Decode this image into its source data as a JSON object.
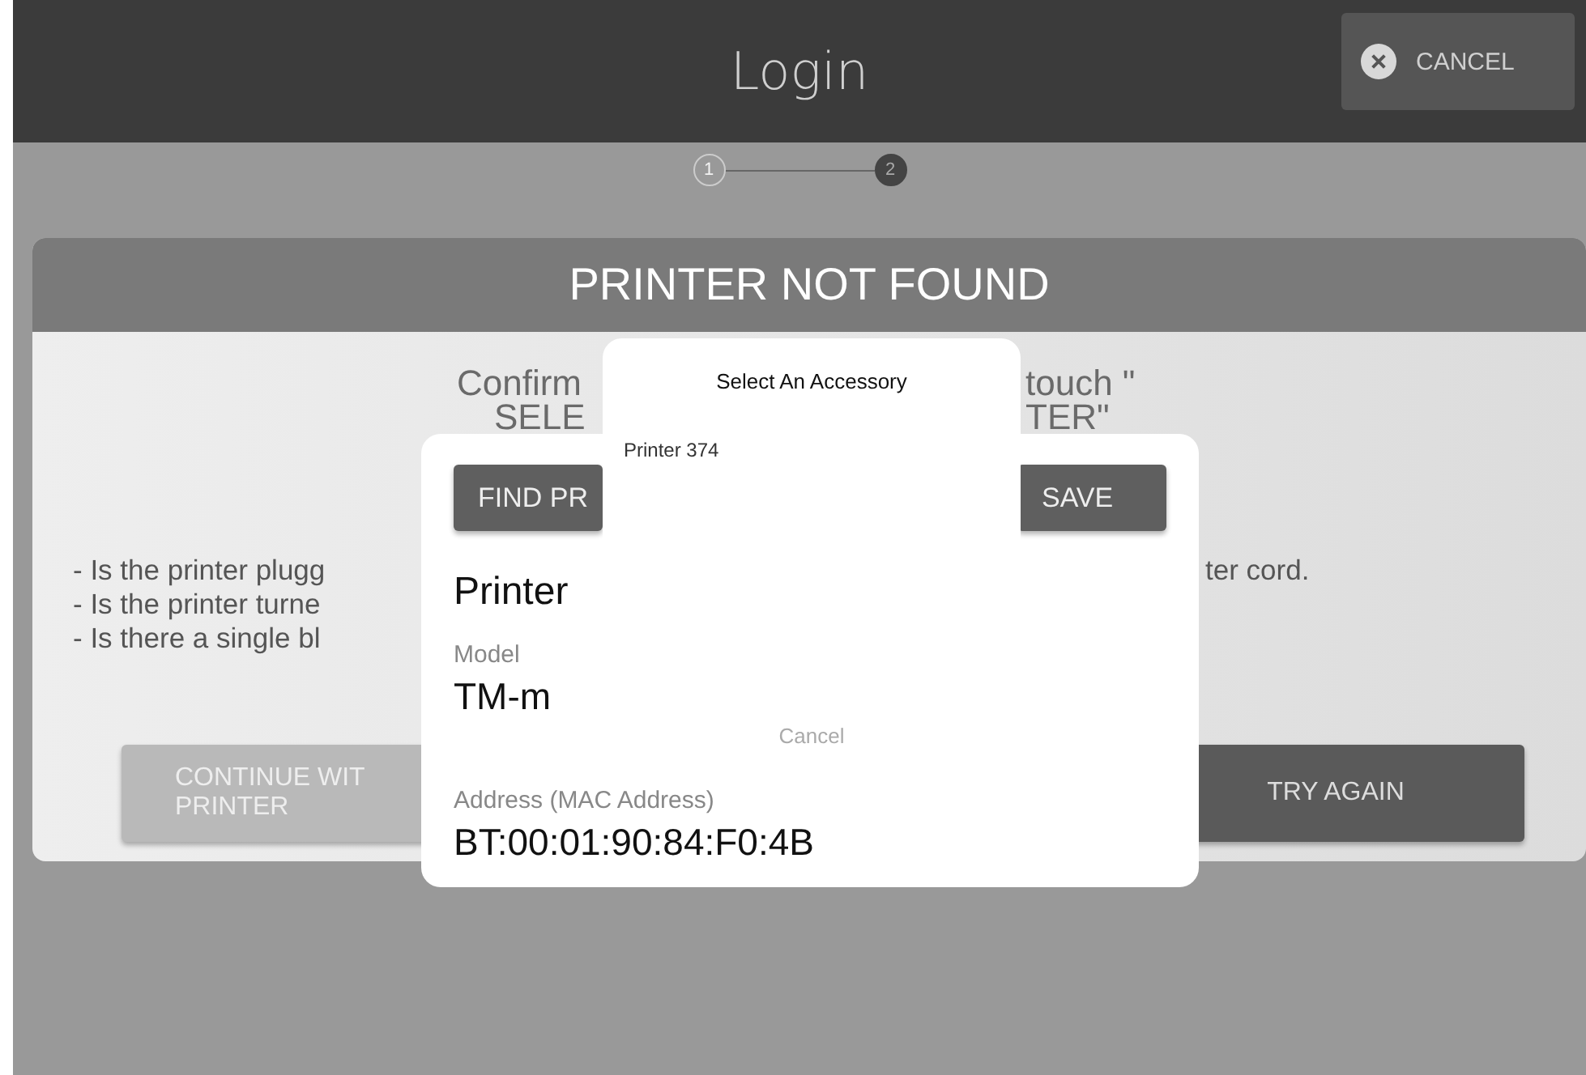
{
  "header": {
    "title": "Login",
    "cancel_button": "CANCEL"
  },
  "stepper": {
    "steps": [
      {
        "label": "1",
        "selected": false
      },
      {
        "label": "2",
        "selected": true
      }
    ]
  },
  "alert": {
    "title": "PRINTER NOT FOUND",
    "message_fragments": [
      "Confirm",
      "touch \"",
      "SELE",
      "TER\""
    ],
    "checklist": [
      "- Is the printer plugg",
      "- Is the printer turne",
      "- Is there a single bl"
    ],
    "checklist_tail": "ter cord.",
    "buttons": [
      {
        "lines": [
          "CONTINUE WIT",
          "PRINTER"
        ],
        "disabled": true
      },
      {
        "lines": [
          "TRY AGAIN"
        ],
        "disabled": false
      }
    ]
  },
  "printer_card": {
    "buttons": [
      "FIND PR",
      "SAVE"
    ],
    "name": "Printer",
    "fields": [
      {
        "label": "Model",
        "value": "TM-m"
      },
      {
        "label": "Address (MAC Address)",
        "value": "BT:00:01:90:84:F0:4B"
      }
    ]
  },
  "accessory_sheet": {
    "title": "Select An Accessory",
    "items": [
      "Printer 374"
    ],
    "cancel": "Cancel"
  }
}
